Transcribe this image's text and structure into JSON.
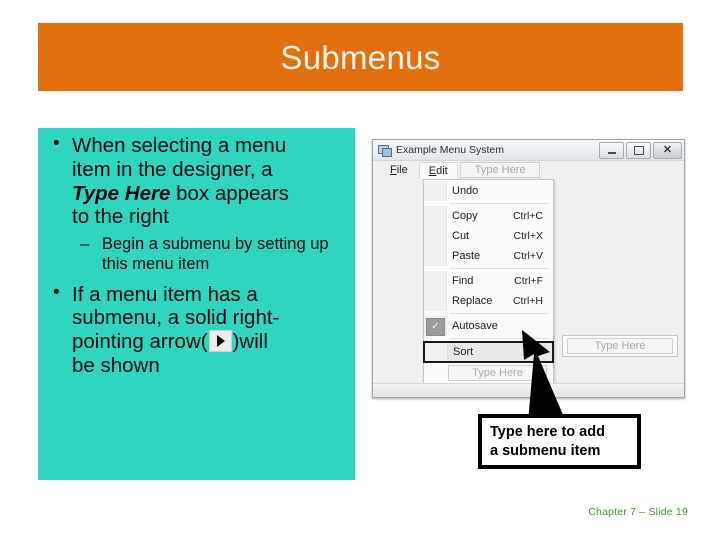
{
  "slide": {
    "title": "Submenus",
    "footer": "Chapter 7 – Slide 19",
    "colors": {
      "banner": "#E2700F",
      "banner_text": "#FDF6EC",
      "panel": "#2FD5BE",
      "footer_text": "#4E8B3C",
      "callout_border": "#000000"
    }
  },
  "content": {
    "bullets": [
      {
        "text_parts": [
          {
            "text": "When selecting a menu item in the designer, a "
          },
          {
            "text": "Type Here",
            "style": "bold-italic"
          },
          {
            "text": " box appears to the right"
          }
        ],
        "part1": "When selecting a menu",
        "part2": "item in the designer, a",
        "emphasis": "Type Here",
        "part3": " box appears",
        "part4": "to the right",
        "sub_bullets": [
          "Begin a submenu by setting up this menu item"
        ]
      },
      {
        "part1": "If a menu item has a",
        "part2": "submenu, a solid right-",
        "part3": "pointing arrow(",
        "part4": ")will",
        "part5": "be shown"
      }
    ]
  },
  "form": {
    "title": "Example Menu System",
    "window_buttons": {
      "minimize": "minimize-icon",
      "maximize": "maximize-icon",
      "close": "close-icon"
    },
    "menubar": [
      {
        "label": "File",
        "accel": "F",
        "state": "normal"
      },
      {
        "label": "Edit",
        "accel": "E",
        "state": "selected"
      },
      {
        "label": "Type Here",
        "state": "placeholder"
      }
    ],
    "dropdown": {
      "items": [
        {
          "label": "Undo",
          "shortcut": "",
          "type": "item"
        },
        {
          "type": "separator"
        },
        {
          "label": "Copy",
          "shortcut": "Ctrl+C",
          "type": "item"
        },
        {
          "label": "Cut",
          "shortcut": "Ctrl+X",
          "type": "item"
        },
        {
          "label": "Paste",
          "shortcut": "Ctrl+V",
          "type": "item"
        },
        {
          "type": "separator"
        },
        {
          "label": "Find",
          "shortcut": "Ctrl+F",
          "type": "item"
        },
        {
          "label": "Replace",
          "shortcut": "Ctrl+H",
          "type": "item"
        },
        {
          "type": "separator"
        },
        {
          "label": "Autosave",
          "shortcut": "",
          "type": "checked",
          "checkmark": "✓"
        },
        {
          "type": "separator"
        },
        {
          "label": "Sort",
          "shortcut": "",
          "type": "submenu",
          "highlighted": true
        }
      ],
      "type_here": "Type Here"
    },
    "submenu_type_here": "Type Here"
  },
  "callout": {
    "line1": "Type here to add",
    "line2": "a submenu item"
  }
}
